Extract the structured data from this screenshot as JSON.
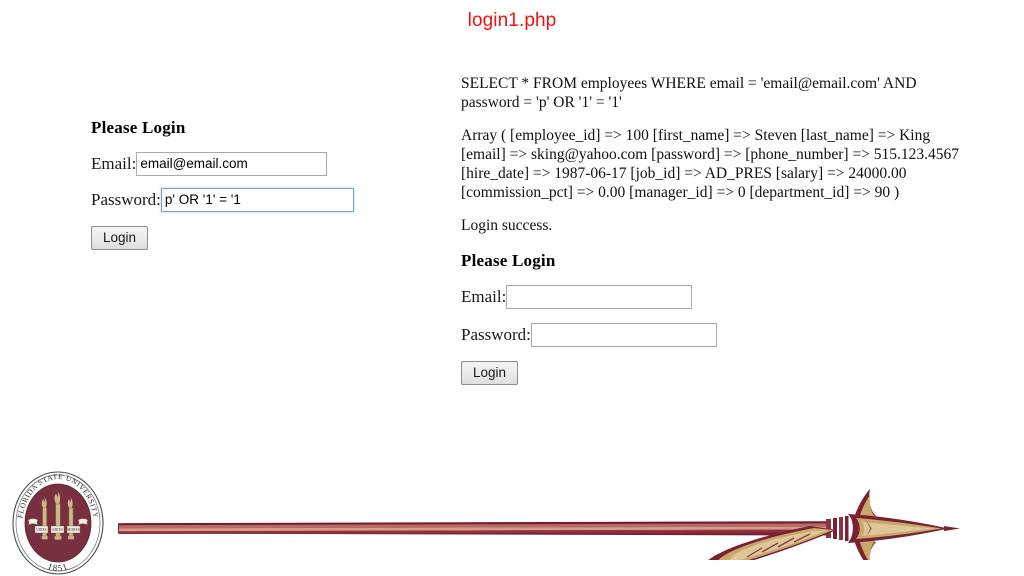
{
  "page": {
    "title": "login1.php",
    "title_color": "#ee1111",
    "background": "#ffffff"
  },
  "left_form": {
    "heading": "Please Login",
    "email_label": "Email:",
    "email_value": "email@email.com",
    "email_placeholder": "",
    "password_label": "Password:",
    "password_value": "p' OR '1' = '1",
    "password_placeholder": "",
    "password_focused": true,
    "submit_label": "Login"
  },
  "output": {
    "sql_query": "SELECT * FROM employees WHERE email = 'email@email.com' AND password = 'p' OR '1' = '1'",
    "array_dump": "Array ( [employee_id] => 100 [first_name] => Steven [last_name] => King [email] => sking@yahoo.com [password] => [phone_number] => 515.123.4567 [hire_date] => 1987-06-17 [job_id] => AD_PRES [salary] => 24000.00 [commission_pct] => 0.00 [manager_id] => 0 [department_id] => 90 )",
    "status_message": "Login success.",
    "record": {
      "employee_id": "100",
      "first_name": "Steven",
      "last_name": "King",
      "email": "sking@yahoo.com",
      "password": "",
      "phone_number": "515.123.4567",
      "hire_date": "1987-06-17",
      "job_id": "AD_PRES",
      "salary": "24000.00",
      "commission_pct": "0.00",
      "manager_id": "0",
      "department_id": "90"
    }
  },
  "right_form": {
    "heading": "Please Login",
    "email_label": "Email:",
    "email_value": "",
    "email_placeholder": "",
    "password_label": "Password:",
    "password_value": "",
    "password_placeholder": "",
    "submit_label": "Login"
  },
  "footer": {
    "seal": {
      "outer_text": "FLORIDA STATE UNIVERSITY",
      "year": "1851",
      "banner_texts": [
        "VIRES",
        "ARTES",
        "MORES"
      ],
      "garnet": "#782F40",
      "gold": "#CEB888"
    },
    "spear": {
      "shaft_color": "#7a2231",
      "highlight_color": "#c98a7e",
      "head_gold": "#c9a96b",
      "head_garnet": "#7a2231"
    }
  }
}
